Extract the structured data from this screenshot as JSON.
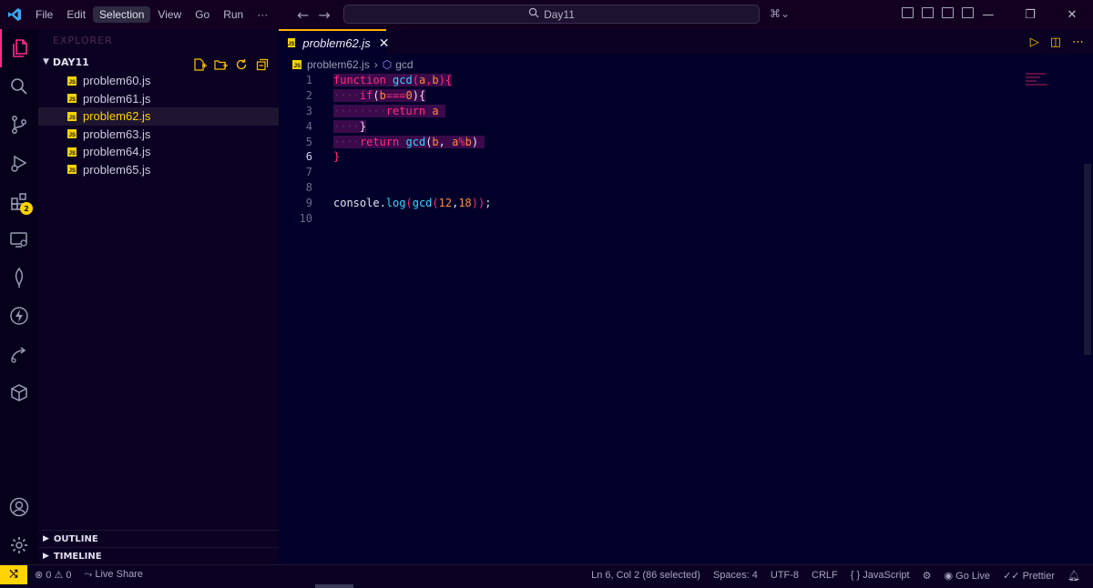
{
  "titlebar": {
    "menu": [
      "File",
      "Edit",
      "Selection",
      "View",
      "Go",
      "Run",
      "···"
    ],
    "search_text": "Day11"
  },
  "activity": {
    "extensions_badge": "2"
  },
  "sidebar": {
    "title": "EXPLORER",
    "folder": "DAY11",
    "files": [
      "problem60.js",
      "problem61.js",
      "problem62.js",
      "problem63.js",
      "problem64.js",
      "problem65.js"
    ],
    "selected_file": "problem62.js",
    "sections": [
      "OUTLINE",
      "TIMELINE"
    ]
  },
  "editor": {
    "tab": "problem62.js",
    "breadcrumb": {
      "file": "problem62.js",
      "symbol": "gcd"
    },
    "line_numbers": [
      "1",
      "2",
      "3",
      "4",
      "5",
      "6",
      "7",
      "8",
      "9",
      "10"
    ],
    "current_line": "6",
    "lines": [
      "function gcd(a,b){",
      "    if(b===0){",
      "        return a",
      "    }",
      "    return gcd(b, a%b)",
      "}",
      "",
      "",
      "console.log(gcd(12,18));",
      ""
    ]
  },
  "statusbar": {
    "problems_errors": "0",
    "problems_warnings": "0",
    "live_share": "Live Share",
    "position": "Ln 6, Col 2 (86 selected)",
    "spaces": "Spaces: 4",
    "encoding": "UTF-8",
    "eol": "CRLF",
    "language": "JavaScript",
    "go_live": "Go Live",
    "prettier": "Prettier"
  },
  "colors": {
    "accent_pink": "#ff2d8f",
    "keyword": "#ff2a7f",
    "function": "#36d7ff",
    "number": "#ff8a3d",
    "tab_border": "#ffb000",
    "remote_yellow": "#ffd400"
  }
}
